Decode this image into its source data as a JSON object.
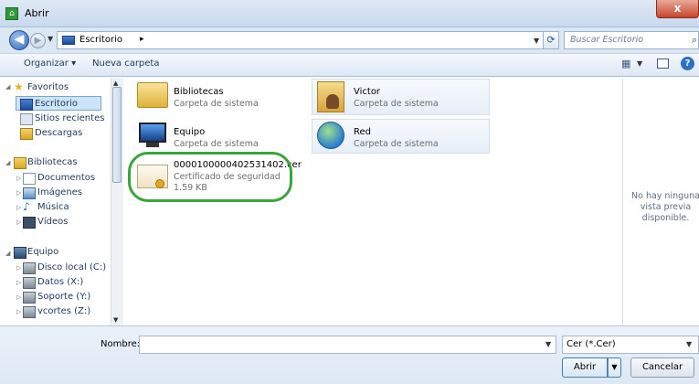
{
  "window": {
    "title": "Abrir",
    "close_glyph": "x"
  },
  "address": {
    "location": "Escritorio",
    "separator": "▸",
    "search_placeholder": "Buscar Escritorio"
  },
  "toolbar": {
    "organize": "Organizar ▾",
    "new_folder": "Nueva carpeta"
  },
  "nav": {
    "favorites": {
      "label": "Favoritos",
      "items": [
        "Escritorio",
        "Sitios recientes",
        "Descargas"
      ],
      "selected": "Escritorio"
    },
    "libraries": {
      "label": "Bibliotecas",
      "items": [
        "Documentos",
        "Imágenes",
        "Música",
        "Vídeos"
      ]
    },
    "computer": {
      "label": "Equipo",
      "items": [
        "Disco local (C:)",
        "Datos  (X:)",
        "Soporte (Y:)",
        "vcortes (Z:)"
      ]
    }
  },
  "content": {
    "items": [
      {
        "name": "Bibliotecas",
        "type": "Carpeta de sistema",
        "icon": "libraries-folder-icon"
      },
      {
        "name": "Victor",
        "type": "Carpeta de sistema",
        "icon": "user-folder-icon"
      },
      {
        "name": "Equipo",
        "type": "Carpeta de sistema",
        "icon": "computer-icon"
      },
      {
        "name": "Red",
        "type": "Carpeta de sistema",
        "icon": "network-icon"
      },
      {
        "name": "0000100000402531402.cer",
        "type": "Certificado de seguridad",
        "size": "1.59 KB",
        "icon": "certificate-icon"
      }
    ]
  },
  "preview": {
    "text": "No hay ninguna vista previa disponible."
  },
  "bottom": {
    "name_label": "Nombre:",
    "name_value": "",
    "filter_value": "Cer (*.Cer)",
    "open_button": "Abrir",
    "cancel_button": "Cancelar"
  },
  "colors": {
    "accent": "#2c6fc6",
    "highlight": "#3aa53a",
    "selection": "#cce4f7"
  }
}
